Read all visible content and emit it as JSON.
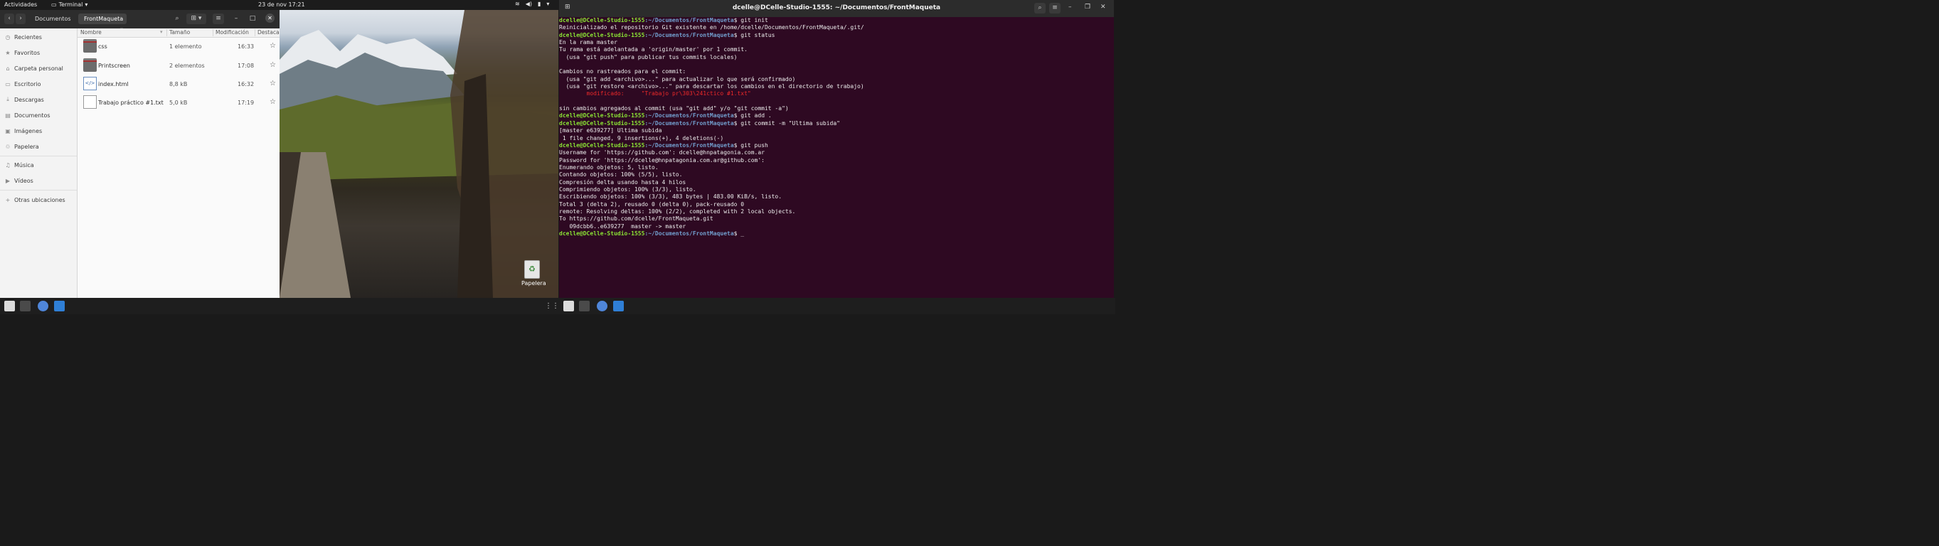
{
  "topbar": {
    "activities": "Actividades",
    "app_name": "Terminal",
    "clock": "23 de nov  17:21"
  },
  "files": {
    "breadcrumbs": [
      "Documentos",
      "FrontMaqueta"
    ],
    "sidebar": [
      {
        "icon": "clock-icon",
        "label": "Recientes"
      },
      {
        "icon": "star-icon",
        "label": "Favoritos"
      },
      {
        "icon": "home-icon",
        "label": "Carpeta personal"
      },
      {
        "icon": "desktop-icon",
        "label": "Escritorio"
      },
      {
        "icon": "download-icon",
        "label": "Descargas"
      },
      {
        "icon": "document-icon",
        "label": "Documentos"
      },
      {
        "icon": "image-icon",
        "label": "Imágenes"
      },
      {
        "icon": "trash-icon",
        "label": "Papelera"
      },
      {
        "icon": "music-icon",
        "label": "Música"
      },
      {
        "icon": "video-icon",
        "label": "Vídeos"
      },
      {
        "icon": "plus-icon",
        "label": "Otras ubicaciones"
      }
    ],
    "columns": {
      "name": "Nombre",
      "size": "Tamaño",
      "modified": "Modificación",
      "starred": "Destaca"
    },
    "rows": [
      {
        "type": "folder",
        "name": "css",
        "size": "1 elemento",
        "time": "16:33"
      },
      {
        "type": "folder",
        "name": "Printscreen",
        "size": "2 elementos",
        "time": "17:08"
      },
      {
        "type": "html",
        "name": "index.html",
        "size": "8,8 kB",
        "time": "16:32"
      },
      {
        "type": "text",
        "name": "Trabajo práctico #1.txt",
        "size": "5,0 kB",
        "time": "17:19"
      }
    ]
  },
  "desktop": {
    "trash_label": "Papelera"
  },
  "terminal": {
    "title": "dcelle@DCelle-Studio-1555: ~/Documentos/FrontMaqueta",
    "prompt_user": "dcelle@DCelle-Studio-1555",
    "prompt_path": ":~/Documentos/FrontMaqueta",
    "lines": [
      {
        "kind": "cmd",
        "text": "$ git init"
      },
      {
        "kind": "out",
        "text": "Reinicializado el repositorio Git existente en /home/dcelle/Documentos/FrontMaqueta/.git/"
      },
      {
        "kind": "cmd",
        "text": "$ git status"
      },
      {
        "kind": "out",
        "text": "En la rama master"
      },
      {
        "kind": "out",
        "text": "Tu rama está adelantada a 'origin/master' por 1 commit."
      },
      {
        "kind": "out",
        "text": "  (usa \"git push\" para publicar tus commits locales)"
      },
      {
        "kind": "out",
        "text": ""
      },
      {
        "kind": "out",
        "text": "Cambios no rastreados para el commit:"
      },
      {
        "kind": "out",
        "text": "  (usa \"git add <archivo>...\" para actualizar lo que será confirmado)"
      },
      {
        "kind": "out",
        "text": "  (usa \"git restore <archivo>...\" para descartar los cambios en el directorio de trabajo)"
      },
      {
        "kind": "red",
        "text": "\tmodificado:     \"Trabajo pr\\303\\241ctico #1.txt\""
      },
      {
        "kind": "out",
        "text": ""
      },
      {
        "kind": "out",
        "text": "sin cambios agregados al commit (usa \"git add\" y/o \"git commit -a\")"
      },
      {
        "kind": "cmd",
        "text": "$ git add ."
      },
      {
        "kind": "cmd",
        "text": "$ git commit -m \"Ultima subida\""
      },
      {
        "kind": "out",
        "text": "[master e639277] Ultima subida"
      },
      {
        "kind": "out",
        "text": " 1 file changed, 9 insertions(+), 4 deletions(-)"
      },
      {
        "kind": "cmd",
        "text": "$ git push"
      },
      {
        "kind": "out",
        "text": "Username for 'https://github.com': dcelle@hnpatagonia.com.ar"
      },
      {
        "kind": "out",
        "text": "Password for 'https://dcelle@hnpatagonia.com.ar@github.com':"
      },
      {
        "kind": "out",
        "text": "Enumerando objetos: 5, listo."
      },
      {
        "kind": "out",
        "text": "Contando objetos: 100% (5/5), listo."
      },
      {
        "kind": "out",
        "text": "Compresión delta usando hasta 4 hilos"
      },
      {
        "kind": "out",
        "text": "Comprimiendo objetos: 100% (3/3), listo."
      },
      {
        "kind": "out",
        "text": "Escribiendo objetos: 100% (3/3), 483 bytes | 483.00 KiB/s, listo."
      },
      {
        "kind": "out",
        "text": "Total 3 (delta 2), reusado 0 (delta 0), pack-reusado 0"
      },
      {
        "kind": "out",
        "text": "remote: Resolving deltas: 100% (2/2), completed with 2 local objects."
      },
      {
        "kind": "out",
        "text": "To https://github.com/dcelle/FrontMaqueta.git"
      },
      {
        "kind": "out",
        "text": "   09dcbb6..e639277  master -> master"
      },
      {
        "kind": "cmd",
        "text": "$ _"
      }
    ]
  },
  "colors": {
    "terminal_bg": "#2e0922",
    "prompt_user": "#8ae234",
    "prompt_path": "#729fcf",
    "modified_red": "#ef2929"
  }
}
